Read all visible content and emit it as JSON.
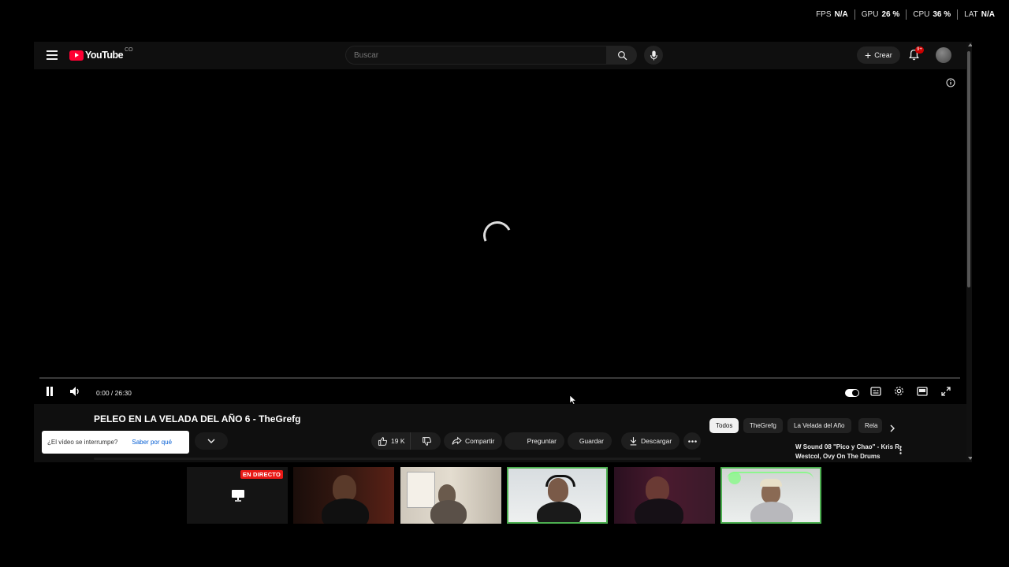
{
  "stats": [
    {
      "label": "FPS",
      "value": "N/A"
    },
    {
      "label": "GPU",
      "value": "26 %"
    },
    {
      "label": "CPU",
      "value": "36 %"
    },
    {
      "label": "LAT",
      "value": "N/A"
    }
  ],
  "header": {
    "logo_text": "YouTube",
    "country": "CO",
    "search_placeholder": "Buscar",
    "create_label": "Crear",
    "notification_count": "9+"
  },
  "player": {
    "time": "0:00 / 26:30",
    "progress": 0
  },
  "video": {
    "title": "PELEO EN LA VELADA DEL AÑO 6 - TheGrefg",
    "likes": "19 K",
    "share_label": "Compartir",
    "ask_label": "Preguntar",
    "save_label": "Guardar",
    "download_label": "Descargar"
  },
  "interrupt_notice": {
    "question": "¿El vídeo se interrumpe?",
    "link": "Saber por qué"
  },
  "chips": [
    "Todos",
    "TheGrefg",
    "La Velada del Año",
    "Rela"
  ],
  "recommendation": {
    "title": "W Sound 08 \"Pico y Chao\" - Kris R, Westcol, Ovy On The Drums"
  },
  "participants": {
    "live_badge": "EN DIRECTO"
  },
  "colors": {
    "youtube_red": "#ff0033",
    "live_red": "#e91916",
    "active_border": "#4caf50",
    "link_blue": "#065fd4"
  }
}
